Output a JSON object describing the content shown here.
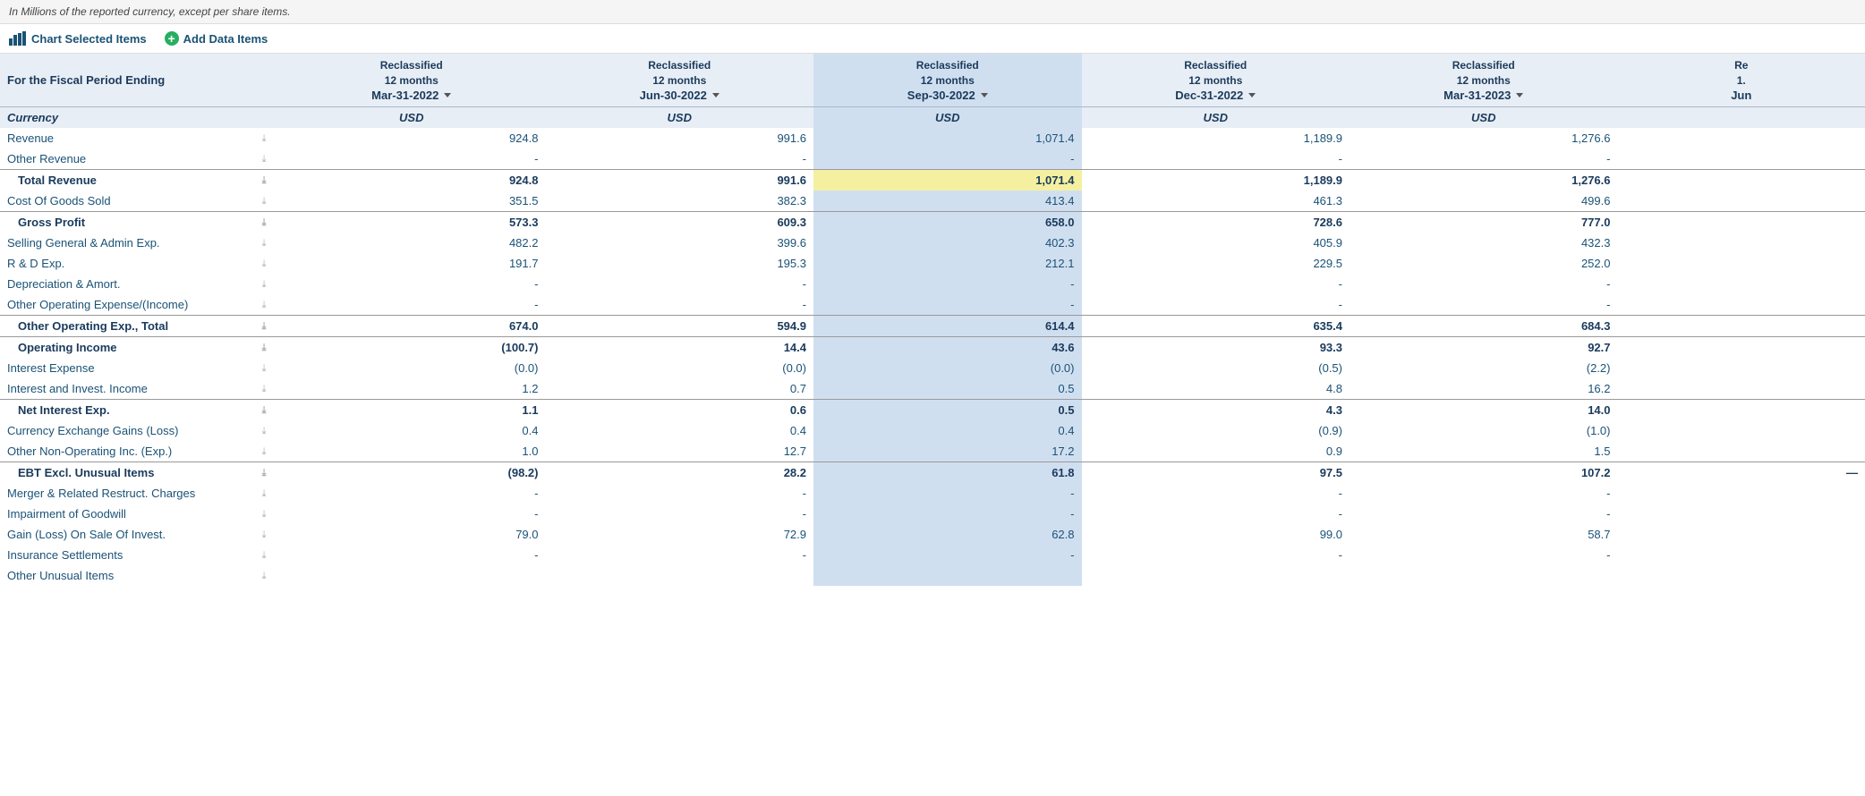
{
  "note": "In Millions of the reported currency, except per share items.",
  "toolbar": {
    "chart_btn": "Chart Selected Items",
    "add_btn": "Add Data Items"
  },
  "columns": [
    {
      "id": "col1",
      "period": "Reclassified\n12 months",
      "date": "Mar-31-2022",
      "currency": "USD",
      "highlight": false
    },
    {
      "id": "col2",
      "period": "Reclassified\n12 months",
      "date": "Jun-30-2022",
      "currency": "USD",
      "highlight": false
    },
    {
      "id": "col3",
      "period": "Reclassified\n12 months",
      "date": "Sep-30-2022",
      "currency": "USD",
      "highlight": true
    },
    {
      "id": "col4",
      "period": "Reclassified\n12 months",
      "date": "Dec-31-2022",
      "currency": "USD",
      "highlight": false
    },
    {
      "id": "col5",
      "period": "Reclassified\n12 months",
      "date": "Mar-31-2023",
      "currency": "USD",
      "highlight": false
    },
    {
      "id": "col6",
      "period": "Re\n1.",
      "date": "Jun",
      "currency": "",
      "highlight": false,
      "partial": true
    }
  ],
  "rows": [
    {
      "type": "data",
      "label": "Revenue",
      "values": [
        "924.8",
        "991.6",
        "1,071.4",
        "1,189.9",
        "1,276.6",
        ""
      ],
      "highlight_col": 2
    },
    {
      "type": "data",
      "label": "Other Revenue",
      "values": [
        "-",
        "-",
        "-",
        "-",
        "-",
        ""
      ],
      "highlight_col": 2
    },
    {
      "type": "subtotal",
      "label": "Total Revenue",
      "values": [
        "924.8",
        "991.6",
        "1,071.4",
        "1,189.9",
        "1,276.6",
        ""
      ],
      "highlight_col": 2,
      "highlight_row": true
    },
    {
      "type": "data",
      "label": "Cost Of Goods Sold",
      "values": [
        "351.5",
        "382.3",
        "413.4",
        "461.3",
        "499.6",
        ""
      ],
      "highlight_col": 2
    },
    {
      "type": "subtotal",
      "label": "Gross Profit",
      "values": [
        "573.3",
        "609.3",
        "658.0",
        "728.6",
        "777.0",
        ""
      ],
      "highlight_col": 2
    },
    {
      "type": "data",
      "label": "Selling General & Admin Exp.",
      "values": [
        "482.2",
        "399.6",
        "402.3",
        "405.9",
        "432.3",
        ""
      ],
      "highlight_col": 2
    },
    {
      "type": "data",
      "label": "R & D Exp.",
      "values": [
        "191.7",
        "195.3",
        "212.1",
        "229.5",
        "252.0",
        ""
      ],
      "highlight_col": 2
    },
    {
      "type": "data",
      "label": "Depreciation & Amort.",
      "values": [
        "-",
        "-",
        "-",
        "-",
        "-",
        ""
      ],
      "highlight_col": 2
    },
    {
      "type": "data",
      "label": "Other Operating Expense/(Income)",
      "values": [
        "-",
        "-",
        "-",
        "-",
        "-",
        ""
      ],
      "highlight_col": 2
    },
    {
      "type": "subtotal",
      "label": "Other Operating Exp., Total",
      "values": [
        "674.0",
        "594.9",
        "614.4",
        "635.4",
        "684.3",
        ""
      ],
      "highlight_col": 2
    },
    {
      "type": "subtotal",
      "label": "Operating Income",
      "values": [
        "(100.7)",
        "14.4",
        "43.6",
        "93.3",
        "92.7",
        ""
      ],
      "highlight_col": 2
    },
    {
      "type": "data",
      "label": "Interest Expense",
      "values": [
        "(0.0)",
        "(0.0)",
        "(0.0)",
        "(0.5)",
        "(2.2)",
        ""
      ],
      "highlight_col": 2
    },
    {
      "type": "data",
      "label": "Interest and Invest. Income",
      "values": [
        "1.2",
        "0.7",
        "0.5",
        "4.8",
        "16.2",
        ""
      ],
      "highlight_col": 2
    },
    {
      "type": "subtotal",
      "label": "Net Interest Exp.",
      "values": [
        "1.1",
        "0.6",
        "0.5",
        "4.3",
        "14.0",
        ""
      ],
      "highlight_col": 2
    },
    {
      "type": "data",
      "label": "Currency Exchange Gains (Loss)",
      "values": [
        "0.4",
        "0.4",
        "0.4",
        "(0.9)",
        "(1.0)",
        ""
      ],
      "highlight_col": 2
    },
    {
      "type": "data",
      "label": "Other Non-Operating Inc. (Exp.)",
      "values": [
        "1.0",
        "12.7",
        "17.2",
        "0.9",
        "1.5",
        ""
      ],
      "highlight_col": 2
    },
    {
      "type": "subtotal",
      "label": "EBT Excl. Unusual Items",
      "values": [
        "(98.2)",
        "28.2",
        "61.8",
        "97.5",
        "107.2",
        "—"
      ],
      "highlight_col": 2
    },
    {
      "type": "data",
      "label": "Merger & Related Restruct. Charges",
      "values": [
        "-",
        "-",
        "-",
        "-",
        "-",
        ""
      ],
      "highlight_col": 2
    },
    {
      "type": "data",
      "label": "Impairment of Goodwill",
      "values": [
        "-",
        "-",
        "-",
        "-",
        "-",
        ""
      ],
      "highlight_col": 2
    },
    {
      "type": "data",
      "label": "Gain (Loss) On Sale Of Invest.",
      "values": [
        "79.0",
        "72.9",
        "62.8",
        "99.0",
        "58.7",
        ""
      ],
      "highlight_col": 2
    },
    {
      "type": "data",
      "label": "Insurance Settlements",
      "values": [
        "-",
        "-",
        "-",
        "-",
        "-",
        ""
      ],
      "highlight_col": 2
    },
    {
      "type": "data",
      "label": "Other Unusual Items",
      "values": [
        "",
        "",
        "",
        "",
        "",
        ""
      ],
      "highlight_col": 2
    }
  ],
  "for_period_label": "For the Fiscal Period Ending",
  "currency_label": "Currency"
}
